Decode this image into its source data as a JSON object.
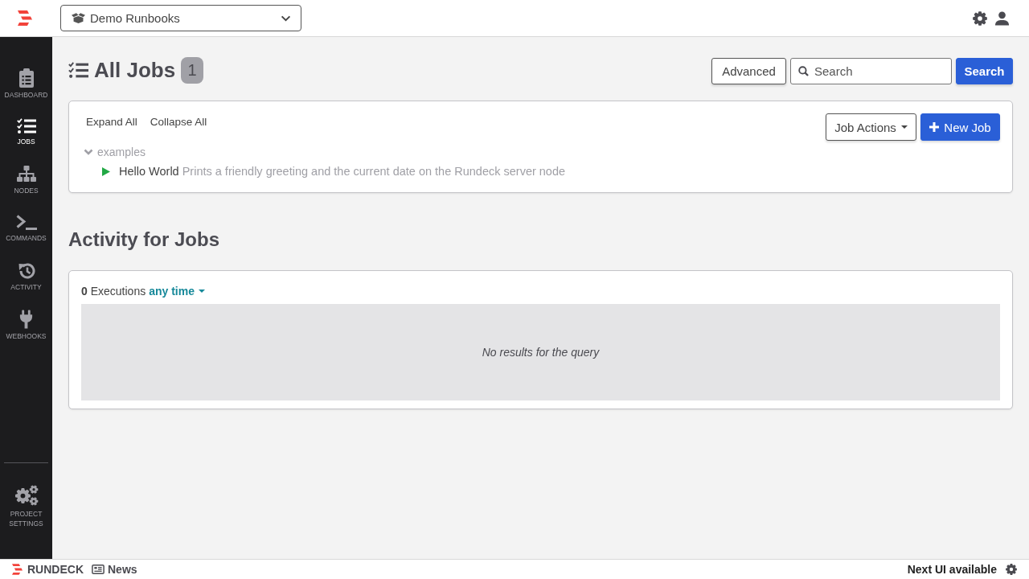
{
  "header": {
    "project_selector": "Demo Runbooks"
  },
  "sidebar": {
    "items": [
      {
        "label": "DASHBOARD",
        "selected": false
      },
      {
        "label": "JOBS",
        "selected": true
      },
      {
        "label": "NODES",
        "selected": false
      },
      {
        "label": "COMMANDS",
        "selected": false
      },
      {
        "label": "ACTIVITY",
        "selected": false
      },
      {
        "label": "WEBHOOKS",
        "selected": false
      }
    ],
    "settings_item": {
      "label": "PROJECT SETTINGS"
    }
  },
  "page": {
    "title": "All Jobs",
    "count": "1",
    "advanced_button": "Advanced",
    "search": {
      "placeholder": "Search"
    },
    "search_button": "Search"
  },
  "jobs_panel": {
    "expand_all": "Expand All",
    "collapse_all": "Collapse All",
    "job_actions_button": "Job Actions",
    "new_job_button": "New Job",
    "groups": [
      {
        "name": "examples",
        "expanded": true,
        "children": [
          {
            "name": "Hello World",
            "description": "Prints a friendly greeting and the current date on the Rundeck server node"
          }
        ]
      }
    ]
  },
  "activity": {
    "title": "Activity for Jobs",
    "summary": "**0** Executions",
    "filter": "any time",
    "empty_message": "No results for the query"
  },
  "footer": {
    "brand": "RUNDECK",
    "news": "News",
    "next_ui": "Next UI available"
  }
}
